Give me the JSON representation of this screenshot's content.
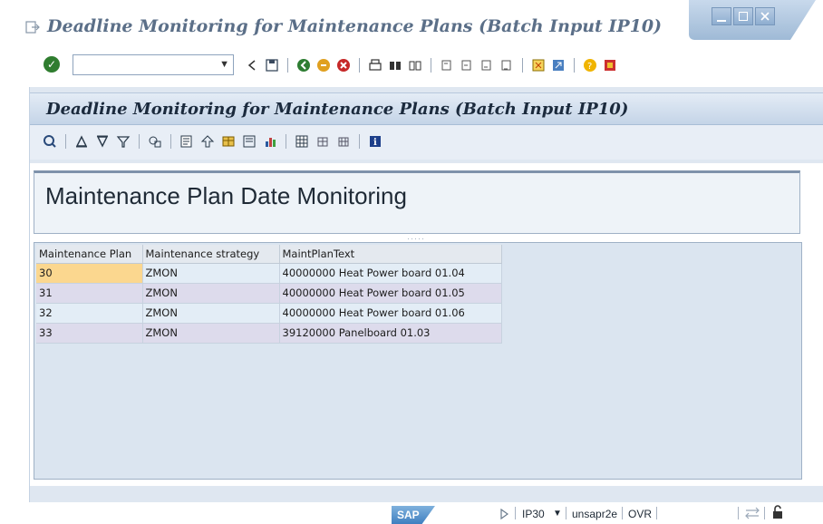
{
  "window": {
    "title": "Deadline Monitoring for Maintenance Plans (Batch Input IP10)"
  },
  "system_toolbar": {
    "command_field_value": "",
    "icons": [
      "enter-icon",
      "back-icon",
      "save-icon",
      "back-green-icon",
      "exit-icon",
      "cancel-icon",
      "print-icon",
      "find-icon",
      "find-next-icon",
      "first-page-icon",
      "prev-page-icon",
      "next-page-icon",
      "last-page-icon",
      "new-session-icon",
      "shortcut-icon",
      "help-icon",
      "customize-layout-icon"
    ]
  },
  "app": {
    "title": "Deadline Monitoring for Maintenance Plans (Batch Input IP10)",
    "header_text": "Maintenance Plan Date Monitoring"
  },
  "grid": {
    "columns": [
      "Maintenance Plan",
      "Maintenance strategy",
      "MaintPlanText"
    ],
    "rows": [
      {
        "plan": "30",
        "strategy": "ZMON",
        "text": "40000000 Heat Power board 01.04"
      },
      {
        "plan": "31",
        "strategy": "ZMON",
        "text": "40000000 Heat Power board 01.05"
      },
      {
        "plan": "32",
        "strategy": "ZMON",
        "text": "40000000 Heat Power board 01.06"
      },
      {
        "plan": "33",
        "strategy": "ZMON",
        "text": "39120000 Panelboard 01.03"
      }
    ],
    "selected_row": 0
  },
  "status_bar": {
    "sap_logo": "SAP",
    "transaction": "IP30",
    "server": "unsapr2e",
    "mode": "OVR"
  },
  "colors": {
    "title": "#5b6f88",
    "header_bg": "#c4d4e7",
    "grid_row_a": "#e3edf6",
    "grid_row_b": "#dddbec",
    "selected_cell": "#fbd78f"
  }
}
